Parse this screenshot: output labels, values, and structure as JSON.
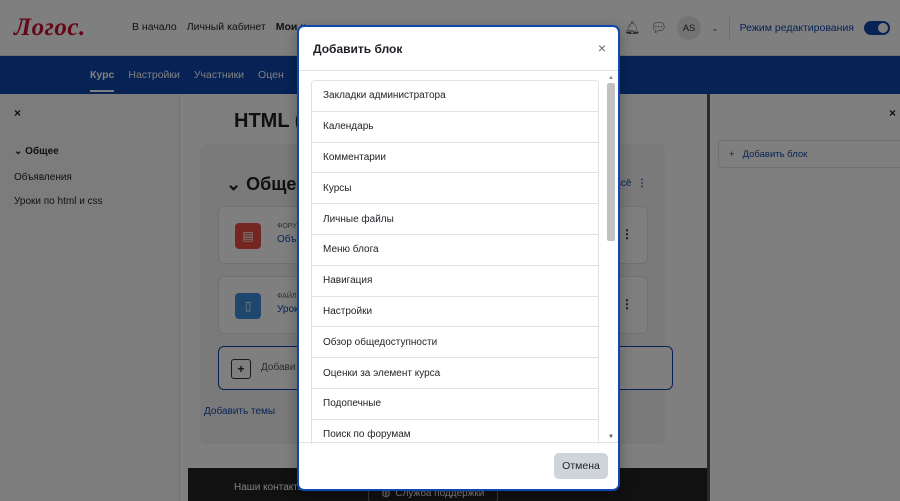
{
  "header": {
    "logo": "Логос.",
    "nav": [
      "В начало",
      "Личный кабинет",
      "Мои к"
    ],
    "avatar_initials": "AS",
    "edit_mode_label": "Режим редактирования"
  },
  "secondary_nav": [
    "Курс",
    "Настройки",
    "Участники",
    "Оцен"
  ],
  "left_drawer": {
    "close": "×",
    "section": "Общее",
    "items": [
      "Объявления",
      "Уроки по html и css"
    ]
  },
  "main": {
    "course_title": "HTML (",
    "section_title": "Общее",
    "collapse_all": "ь всё",
    "activities": [
      {
        "meta": "ФОРУ",
        "name": "Объ",
        "icon": "▤",
        "color": "#e84e40"
      },
      {
        "meta": "ФАЙЛ",
        "name": "Урок",
        "icon": "🗋",
        "color": "#3f8fdc"
      }
    ],
    "add_activity_label": "Добави",
    "add_topics": "Добавить темы"
  },
  "right_drawer": {
    "close": "×",
    "add_block_label": "Добавить блок"
  },
  "footer": {
    "contacts": "Наши контакты",
    "support": "Служба поддержки"
  },
  "modal": {
    "title": "Добавить блок",
    "close": "×",
    "items": [
      "Закладки администратора",
      "Календарь",
      "Комментарии",
      "Курсы",
      "Личные файлы",
      "Меню блога",
      "Навигация",
      "Настройки",
      "Обзор общедоступности",
      "Оценки за элемент курса",
      "Подопечные",
      "Поиск по форумам"
    ],
    "cancel_label": "Отмена"
  }
}
